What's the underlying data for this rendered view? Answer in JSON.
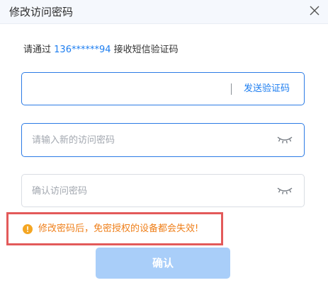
{
  "dialog": {
    "title": "修改访问密码",
    "close_icon": "close-icon"
  },
  "hint": {
    "prefix": "请通过",
    "phone": "136******94",
    "suffix": "接收短信验证码"
  },
  "code_field": {
    "value": "",
    "send_label": "发送验证码"
  },
  "new_password_field": {
    "value": "",
    "placeholder": "请输入新的访问密码",
    "icon": "eye-closed-icon"
  },
  "confirm_password_field": {
    "value": "",
    "placeholder": "确认访问密码",
    "icon": "eye-closed-icon"
  },
  "warning": {
    "icon": "warning-icon",
    "text": "修改密码后，免密授权的设备都会失效!"
  },
  "confirm_button": {
    "label": "确认"
  },
  "colors": {
    "accent": "#1e7ef0",
    "warning": "#ef7f1a",
    "highlight_border": "#e35a5a",
    "button_disabled": "#a9cef9"
  }
}
